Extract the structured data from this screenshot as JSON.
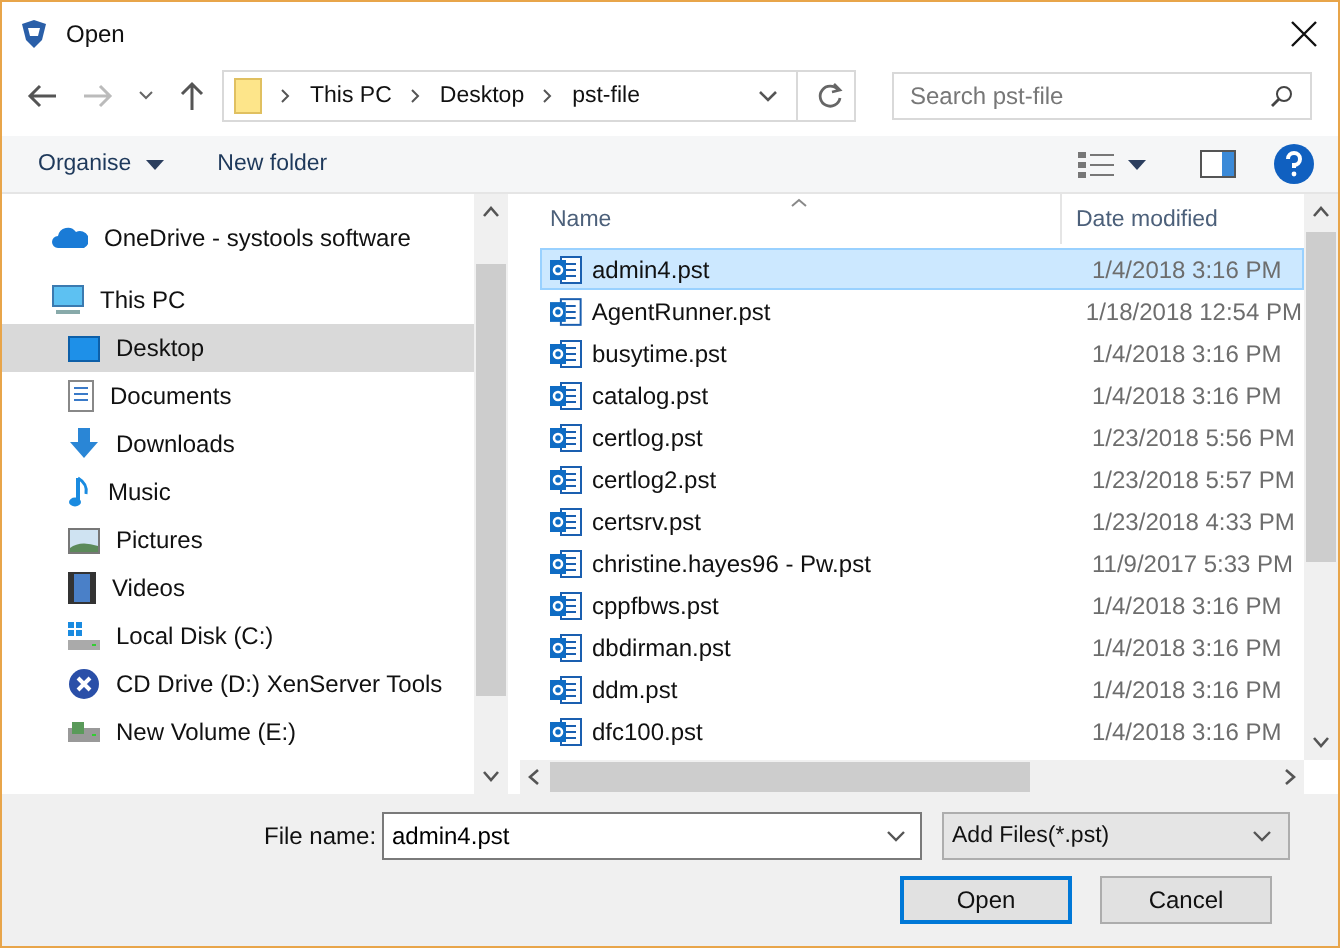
{
  "window": {
    "title": "Open"
  },
  "address": {
    "crumbs": [
      "This PC",
      "Desktop",
      "pst-file"
    ]
  },
  "search": {
    "placeholder": "Search pst-file"
  },
  "toolbar": {
    "organise": "Organise",
    "new_folder": "New folder"
  },
  "sidebar": {
    "items": [
      {
        "label": "OneDrive - systools software",
        "selected": false
      },
      {
        "label": "This PC",
        "selected": false,
        "children": [
          {
            "label": "Desktop",
            "selected": true
          },
          {
            "label": "Documents",
            "selected": false
          },
          {
            "label": "Downloads",
            "selected": false
          },
          {
            "label": "Music",
            "selected": false
          },
          {
            "label": "Pictures",
            "selected": false
          },
          {
            "label": "Videos",
            "selected": false
          },
          {
            "label": "Local Disk (C:)",
            "selected": false
          },
          {
            "label": "CD Drive (D:) XenServer Tools",
            "selected": false
          },
          {
            "label": "New Volume (E:)",
            "selected": false
          }
        ]
      }
    ]
  },
  "table": {
    "columns": [
      "Name",
      "Date modified"
    ],
    "rows": [
      {
        "name": "admin4.pst",
        "date": "1/4/2018 3:16 PM",
        "selected": true
      },
      {
        "name": "AgentRunner.pst",
        "date": "1/18/2018 12:54 PM",
        "selected": false
      },
      {
        "name": "busytime.pst",
        "date": "1/4/2018 3:16 PM",
        "selected": false
      },
      {
        "name": "catalog.pst",
        "date": "1/4/2018 3:16 PM",
        "selected": false
      },
      {
        "name": "certlog.pst",
        "date": "1/23/2018 5:56 PM",
        "selected": false
      },
      {
        "name": "certlog2.pst",
        "date": "1/23/2018 5:57 PM",
        "selected": false
      },
      {
        "name": "certsrv.pst",
        "date": "1/23/2018 4:33 PM",
        "selected": false
      },
      {
        "name": "christine.hayes96 - Pw.pst",
        "date": "11/9/2017 5:33 PM",
        "selected": false
      },
      {
        "name": "cppfbws.pst",
        "date": "1/4/2018 3:16 PM",
        "selected": false
      },
      {
        "name": "dbdirman.pst",
        "date": "1/4/2018 3:16 PM",
        "selected": false
      },
      {
        "name": "ddm.pst",
        "date": "1/4/2018 3:16 PM",
        "selected": false
      },
      {
        "name": "dfc100.pst",
        "date": "1/4/2018 3:16 PM",
        "selected": false
      }
    ]
  },
  "footer": {
    "file_name_label": "File name:",
    "file_name": "admin4.pst",
    "file_type": "Add Files(*.pst)",
    "buttons": [
      "Open",
      "Cancel"
    ]
  }
}
